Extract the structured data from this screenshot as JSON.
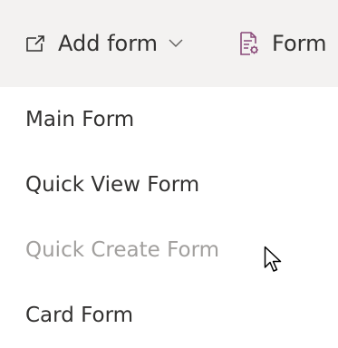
{
  "toolbar": {
    "add_form_label": "Add form",
    "form_label": "Form",
    "icons": {
      "add_form": "new-window-icon",
      "chevron": "chevron-down-icon",
      "form_settings": "form-settings-icon"
    },
    "accent_color": "#8a4b7a"
  },
  "menu": {
    "items": [
      {
        "label": "Main Form",
        "enabled": true
      },
      {
        "label": "Quick View Form",
        "enabled": true
      },
      {
        "label": "Quick Create Form",
        "enabled": false
      },
      {
        "label": "Card Form",
        "enabled": true
      }
    ]
  },
  "colors": {
    "text": "#323130",
    "disabled_text": "#a19f9d",
    "toolbar_bg": "#f3f2f1"
  }
}
